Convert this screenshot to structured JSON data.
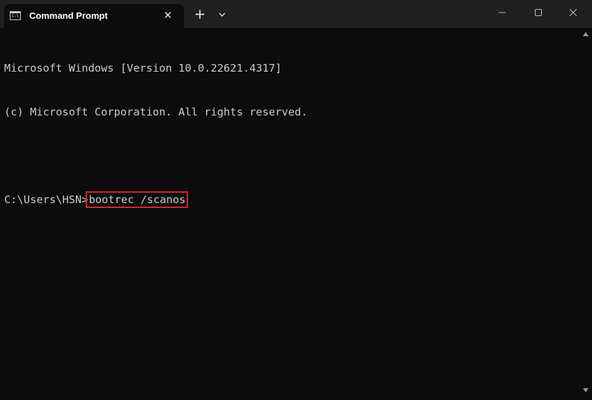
{
  "tab": {
    "title": "Command Prompt",
    "icon": "cmd-icon",
    "icon_glyph": "C:\\_",
    "close_glyph": "✕"
  },
  "toolbar": {
    "new_tab_glyph": "+",
    "dropdown_icon": "chevron-down-icon"
  },
  "window_controls": {
    "minimize_icon": "minimize-icon",
    "maximize_icon": "maximize-icon",
    "close_icon": "close-icon"
  },
  "console": {
    "lines": [
      "Microsoft Windows [Version 10.0.22621.4317]",
      "(c) Microsoft Corporation. All rights reserved."
    ],
    "prompt": "C:\\Users\\HSN>",
    "command": "bootrec /scanos"
  },
  "colors": {
    "background": "#0c0c0c",
    "titlebar": "#202020",
    "text": "#cccccc",
    "highlight": "#d42a2a"
  }
}
